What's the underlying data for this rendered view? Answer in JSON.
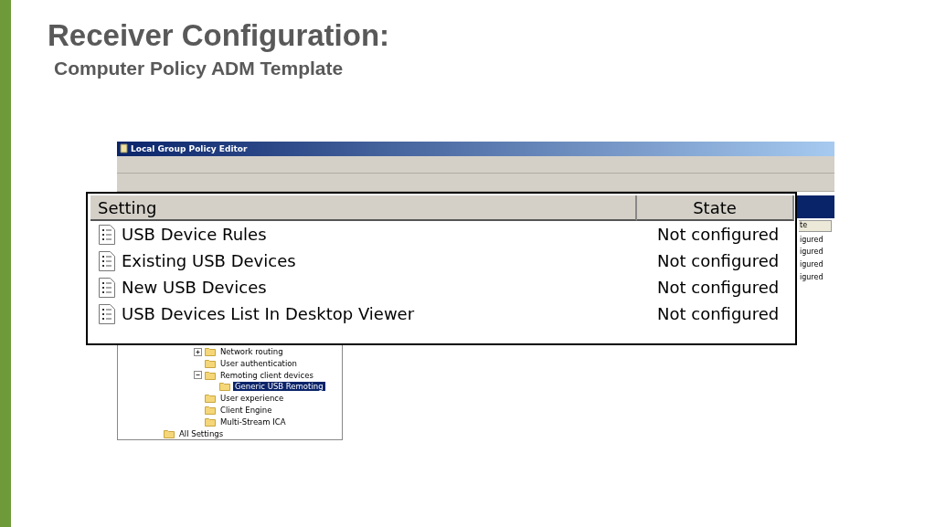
{
  "slide": {
    "title": "Receiver Configuration:",
    "subtitle": "Computer Policy ADM Template"
  },
  "window": {
    "title": "Local Group Policy Editor",
    "details_pane": {
      "column_header": "te",
      "cells": [
        "igured",
        "igured",
        "igured",
        "igured"
      ]
    },
    "tree_branch": [
      {
        "label": "Network routing",
        "expanded": false,
        "selected": false
      },
      {
        "label": "User authentication",
        "selected": false
      },
      {
        "label": "Remoting client devices",
        "expanded": true,
        "selected": false,
        "children": [
          {
            "label": "Generic USB Remoting",
            "selected": true
          }
        ]
      },
      {
        "label": "User experience",
        "selected": false
      },
      {
        "label": "Client Engine",
        "selected": false
      },
      {
        "label": "Multi-Stream ICA",
        "selected": false
      }
    ],
    "tree_root_items": [
      {
        "label": "All Settings",
        "selected": false
      }
    ]
  },
  "callout": {
    "columns": [
      "Setting",
      "State"
    ],
    "rows": [
      {
        "setting": "USB Device Rules",
        "state": "Not configured"
      },
      {
        "setting": "Existing USB Devices",
        "state": "Not configured"
      },
      {
        "setting": "New USB Devices",
        "state": "Not configured"
      },
      {
        "setting": "USB Devices List In Desktop Viewer",
        "state": "Not configured"
      }
    ]
  }
}
